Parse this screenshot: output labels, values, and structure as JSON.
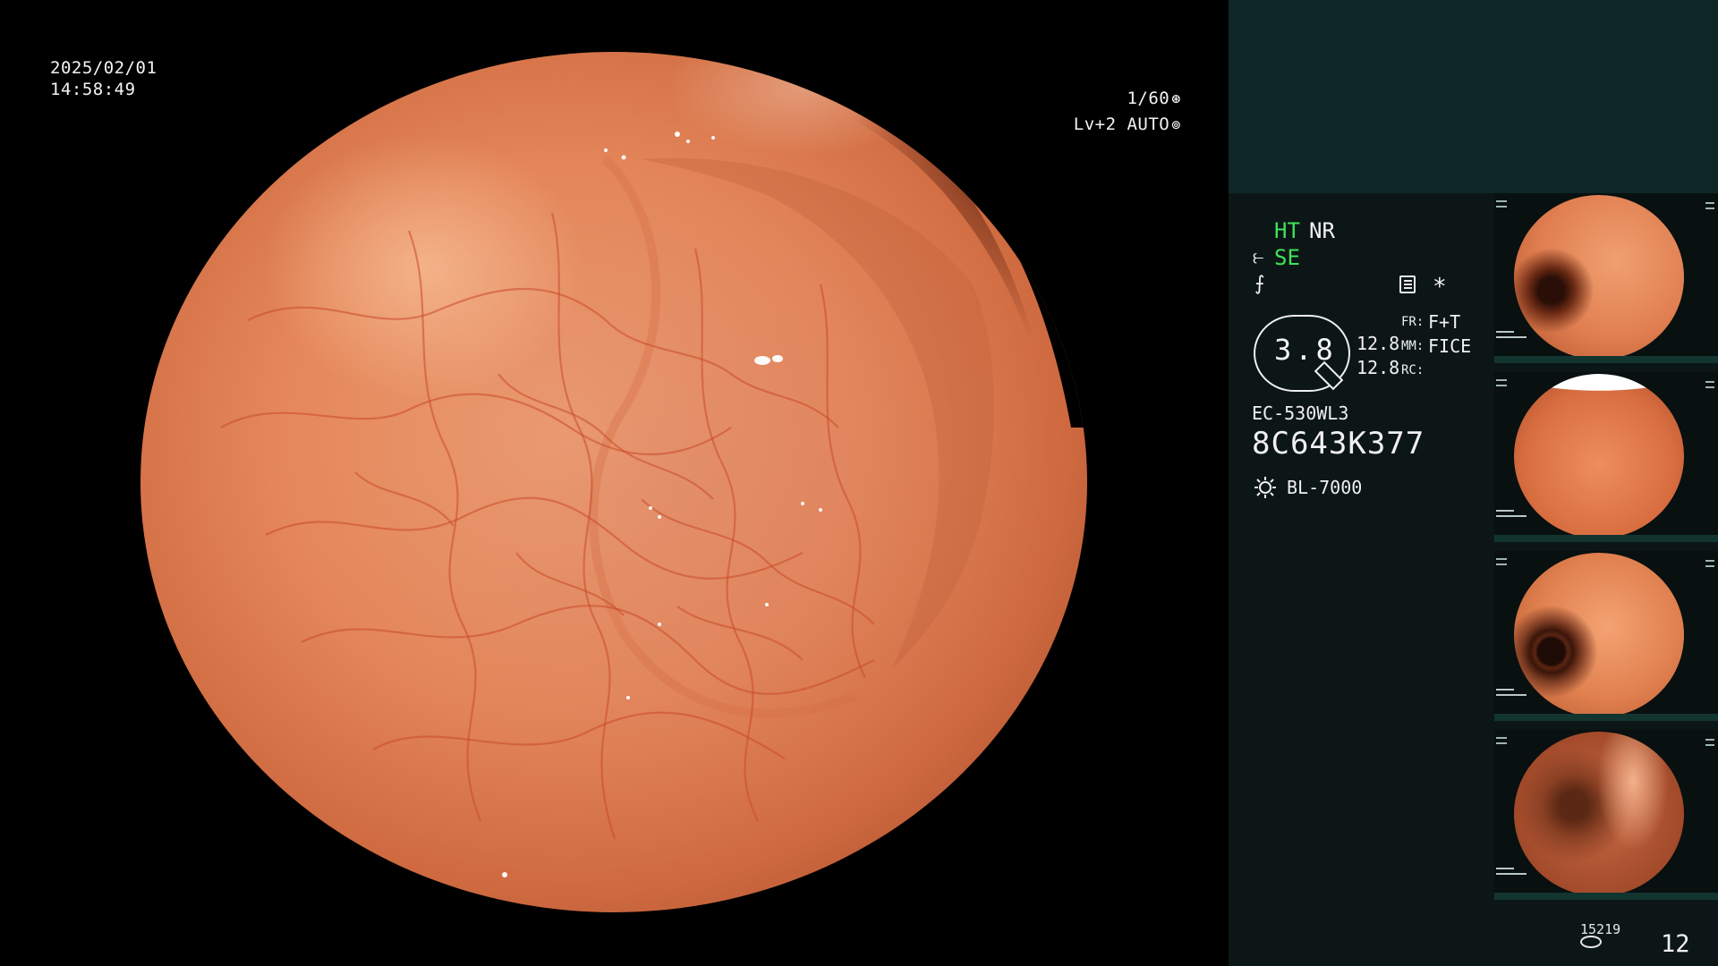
{
  "overlay": {
    "date": "2025/02/01",
    "time": "14:58:49",
    "shutter": "1/60",
    "iris": "Lv+2 AUTO"
  },
  "panel": {
    "ht": "HT",
    "nr": "NR",
    "se": "SE",
    "zoom": "3.8",
    "value_1": "12.8",
    "value_2": "12.8",
    "fr_key": "FR:",
    "fr_value": "F+T",
    "mm_key": "MM:",
    "mm_value": "FICE",
    "rc_key": "RC:",
    "scope_model": "EC-530WL3",
    "scope_serial": "8C643K377",
    "light_source": "BL-7000",
    "frame_counter": "15219",
    "page_number": "12"
  },
  "icons": {
    "shutter": "aperture-icon",
    "iris": "iris-icon",
    "structure": "structure-enhance-icon",
    "color": "color-enhance-icon",
    "menu": "menu-list-icon",
    "star": "asterisk-icon",
    "light": "sun-icon",
    "storage": "disk-icon"
  },
  "colors": {
    "active_green": "#3fe35a",
    "panel_bg": "#0c1616",
    "panel_top_bg": "#0e2626"
  }
}
